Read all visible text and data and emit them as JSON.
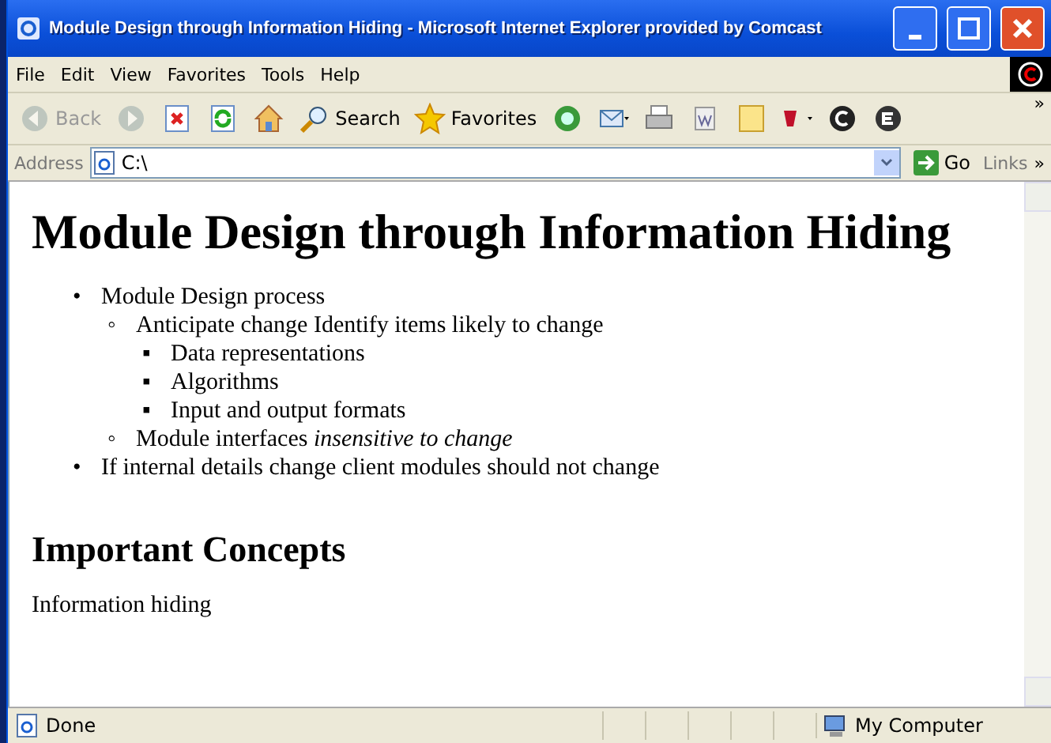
{
  "window": {
    "title": "Module Design through Information Hiding - Microsoft Internet Explorer provided by Comcast"
  },
  "menu": [
    {
      "label": "File"
    },
    {
      "label": "Edit"
    },
    {
      "label": "View"
    },
    {
      "label": "Favorites"
    },
    {
      "label": "Tools"
    },
    {
      "label": "Help"
    }
  ],
  "toolbar": [
    {
      "kind": "back",
      "label": "Back",
      "disabled": true
    },
    {
      "kind": "forward",
      "disabled": true
    },
    {
      "kind": "stop"
    },
    {
      "kind": "refresh"
    },
    {
      "kind": "home"
    },
    {
      "kind": "search",
      "label": "Search"
    },
    {
      "kind": "favorites",
      "label": "Favorites"
    },
    {
      "kind": "media"
    },
    {
      "kind": "mail"
    },
    {
      "kind": "print"
    },
    {
      "kind": "edit"
    },
    {
      "kind": "note"
    },
    {
      "kind": "yahoo"
    },
    {
      "kind": "circle-c"
    },
    {
      "kind": "circle-e"
    }
  ],
  "toolbar_chevron": "»",
  "address": {
    "label": "Address",
    "value": "C:\\",
    "go": "Go",
    "links": "Links",
    "links_chevron": "»"
  },
  "page": {
    "heading": "Module Design through Information Hiding",
    "list": [
      {
        "marker": "•",
        "text": "Module Design process",
        "children": [
          {
            "marker": "◦",
            "text": "Anticipate change Identify items likely to change",
            "children": [
              {
                "marker": "▪",
                "text": "Data representations"
              },
              {
                "marker": "▪",
                "text": "Algorithms"
              },
              {
                "marker": "▪",
                "text": "Input and output formats"
              }
            ]
          },
          {
            "marker": "◦",
            "text": "Module interfaces *insensitive to change*"
          }
        ]
      },
      {
        "marker": "•",
        "text": "If internal details change client modules should not change"
      }
    ],
    "subheading": "Important Concepts",
    "paragraph": "Information hiding"
  },
  "status_bar": {
    "status": "Done",
    "zone": "My Computer"
  }
}
